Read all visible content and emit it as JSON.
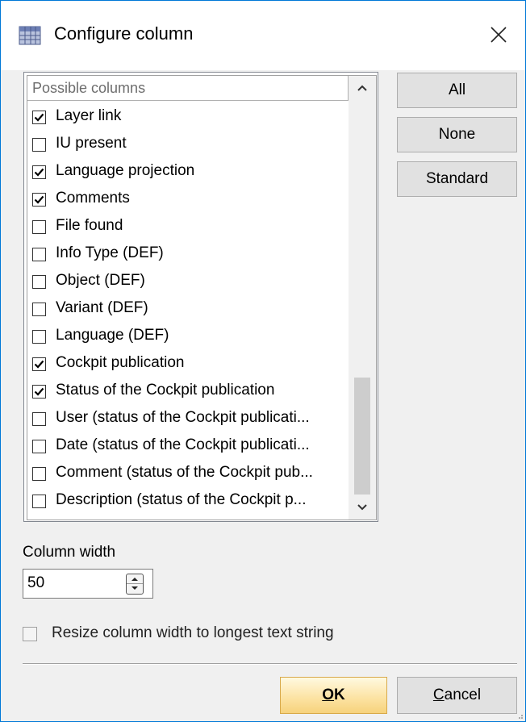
{
  "dialog": {
    "title": "Configure column",
    "icon": "table-grid-icon"
  },
  "column_list": {
    "header": "Possible columns",
    "items": [
      {
        "label": "Layer link",
        "checked": true
      },
      {
        "label": "IU present",
        "checked": false
      },
      {
        "label": "Language projection",
        "checked": true
      },
      {
        "label": "Comments",
        "checked": true
      },
      {
        "label": "File found",
        "checked": false
      },
      {
        "label": "Info Type (DEF)",
        "checked": false
      },
      {
        "label": "Object (DEF)",
        "checked": false
      },
      {
        "label": "Variant (DEF)",
        "checked": false
      },
      {
        "label": "Language (DEF)",
        "checked": false
      },
      {
        "label": "Cockpit publication",
        "checked": true
      },
      {
        "label": "Status of the Cockpit publication",
        "checked": true
      },
      {
        "label": "User (status of the Cockpit publicati...",
        "checked": false
      },
      {
        "label": "Date (status of the Cockpit publicati...",
        "checked": false
      },
      {
        "label": "Comment (status of the Cockpit pub...",
        "checked": false
      },
      {
        "label": "Description (status of the Cockpit p...",
        "checked": false
      }
    ]
  },
  "side_buttons": {
    "all": "All",
    "none": "None",
    "standard": "Standard"
  },
  "column_width": {
    "label": "Column width",
    "value": "50"
  },
  "resize_option": {
    "label": "Resize column width to longest text string",
    "checked": false
  },
  "footer": {
    "ok_mnemonic": "O",
    "ok_rest": "K",
    "cancel_mnemonic": "C",
    "cancel_rest": "ancel"
  }
}
